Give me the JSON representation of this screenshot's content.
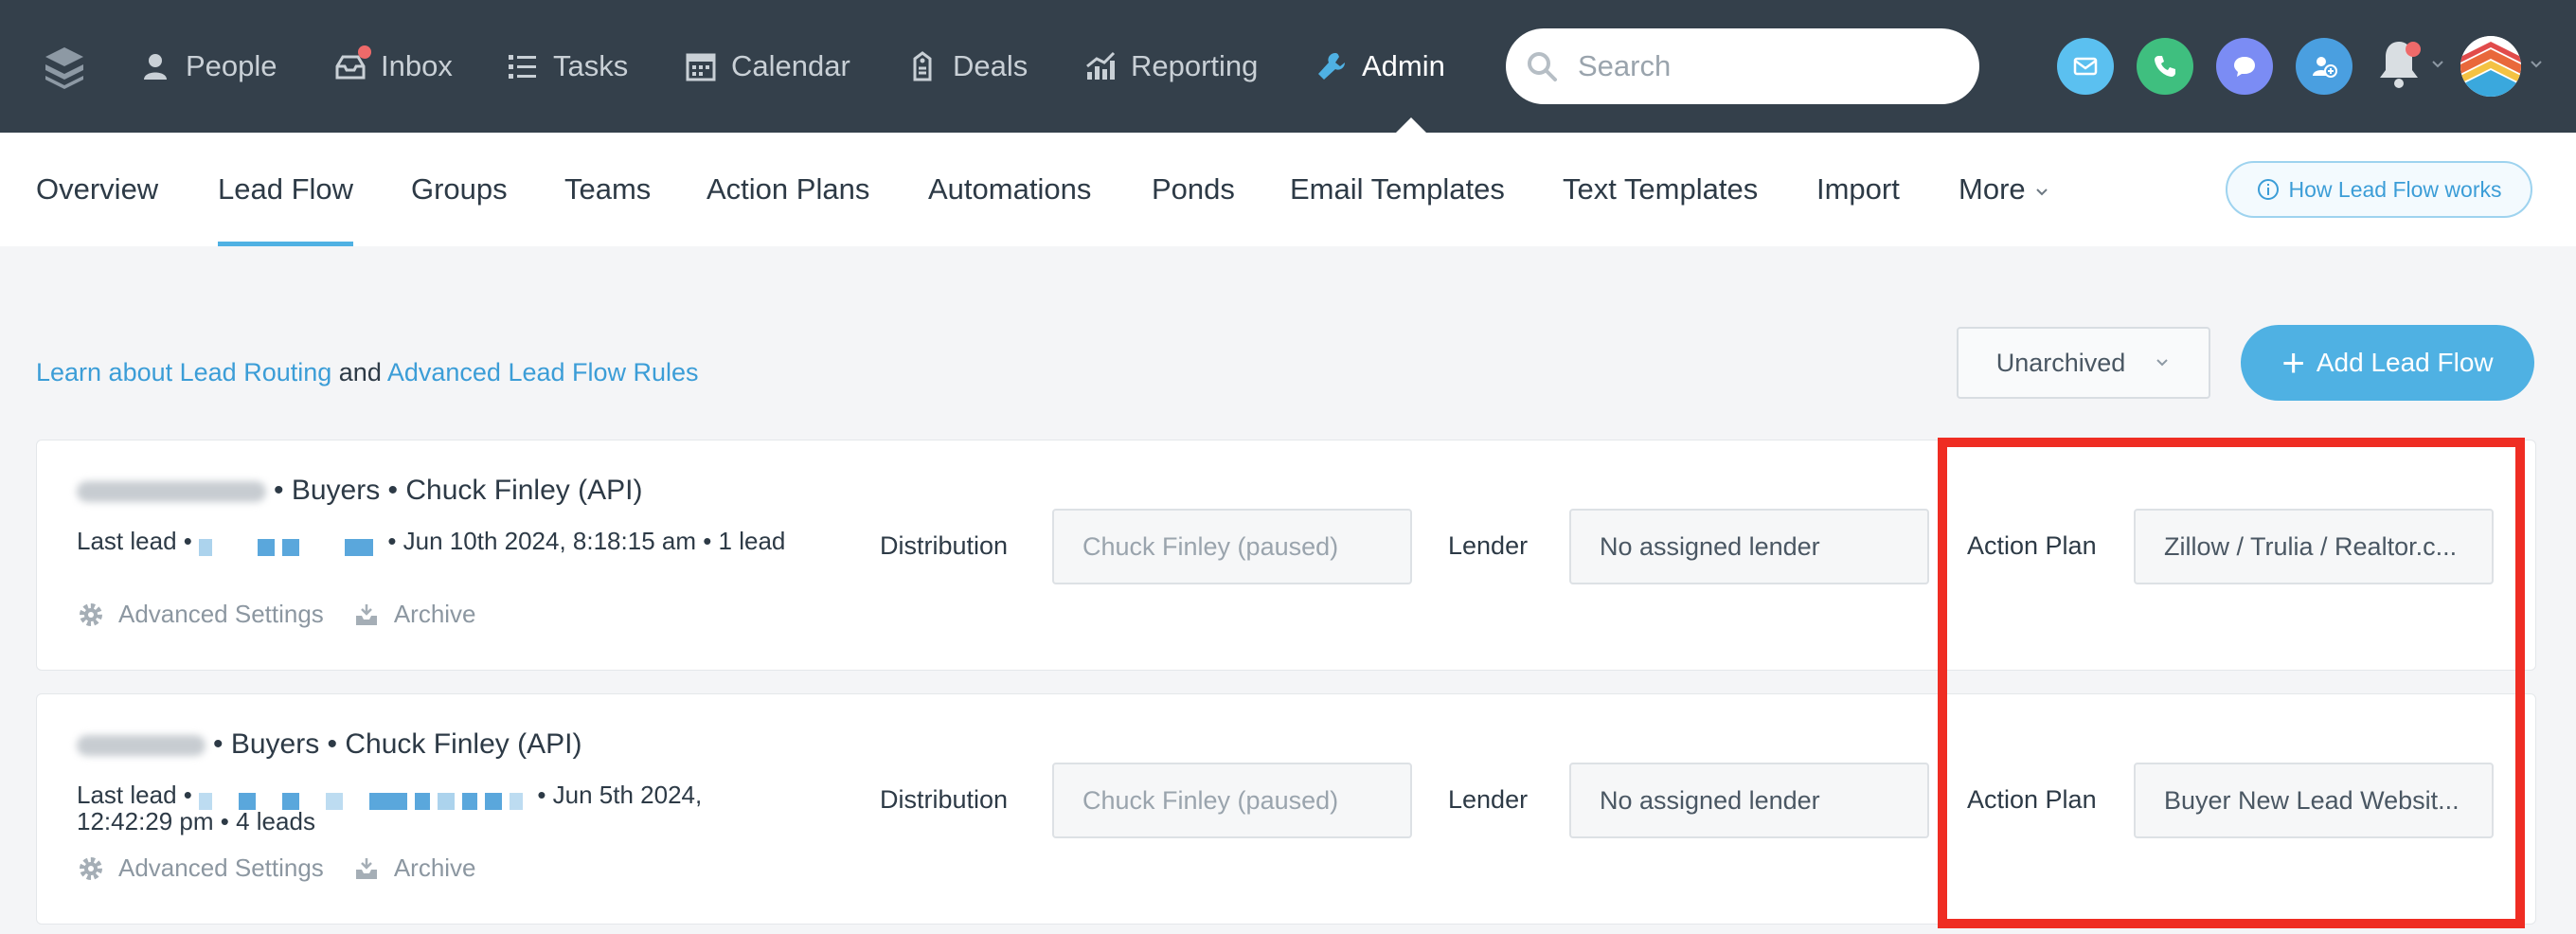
{
  "topnav": {
    "items": [
      {
        "label": "People",
        "icon": "person-icon"
      },
      {
        "label": "Inbox",
        "icon": "inbox-icon"
      },
      {
        "label": "Tasks",
        "icon": "list-icon"
      },
      {
        "label": "Calendar",
        "icon": "calendar-icon"
      },
      {
        "label": "Deals",
        "icon": "deals-icon"
      },
      {
        "label": "Reporting",
        "icon": "chart-icon"
      },
      {
        "label": "Admin",
        "icon": "wrench-icon"
      }
    ],
    "active": "Admin",
    "search_placeholder": "Search",
    "action_colors": {
      "email": "#5bc0f0",
      "phone": "#3fbf7f",
      "chat": "#7b8cf4",
      "add_contact": "#4a9fe0"
    }
  },
  "subnav": {
    "tabs": [
      "Overview",
      "Lead Flow",
      "Groups",
      "Teams",
      "Action Plans",
      "Automations",
      "Ponds",
      "Email Templates",
      "Text Templates",
      "Import",
      "More"
    ],
    "active": "Lead Flow",
    "help_button": "How Lead Flow works"
  },
  "toolbar": {
    "learn_link": "Learn about Lead Routing",
    "and_text": "and",
    "rules_link": "Advanced Lead Flow Rules",
    "filter_value": "Unarchived",
    "add_button": "Add Lead Flow"
  },
  "flows": [
    {
      "title_suffix": "• Buyers • Chuck Finley (API)",
      "last_lead_label": "Last lead •",
      "last_lead_info": "• Jun 10th 2024, 8:18:15 am • 1 lead",
      "advanced_settings": "Advanced Settings",
      "archive": "Archive",
      "distribution_label": "Distribution",
      "distribution_value": "Chuck Finley (paused)",
      "lender_label": "Lender",
      "lender_value": "No assigned lender",
      "action_plan_label": "Action Plan",
      "action_plan_value": "Zillow / Trulia / Realtor.c..."
    },
    {
      "title_suffix": "• Buyers • Chuck Finley (API)",
      "last_lead_label": "Last lead •",
      "last_lead_info": "• Jun 5th 2024, 12:42:29 pm • 4 leads",
      "advanced_settings": "Advanced Settings",
      "archive": "Archive",
      "distribution_label": "Distribution",
      "distribution_value": "Chuck Finley (paused)",
      "lender_label": "Lender",
      "lender_value": "No assigned lender",
      "action_plan_label": "Action Plan",
      "action_plan_value": "Buyer New Lead Websit..."
    }
  ],
  "accent_color": "#4fb1e3",
  "highlight_color": "#ef2d23"
}
